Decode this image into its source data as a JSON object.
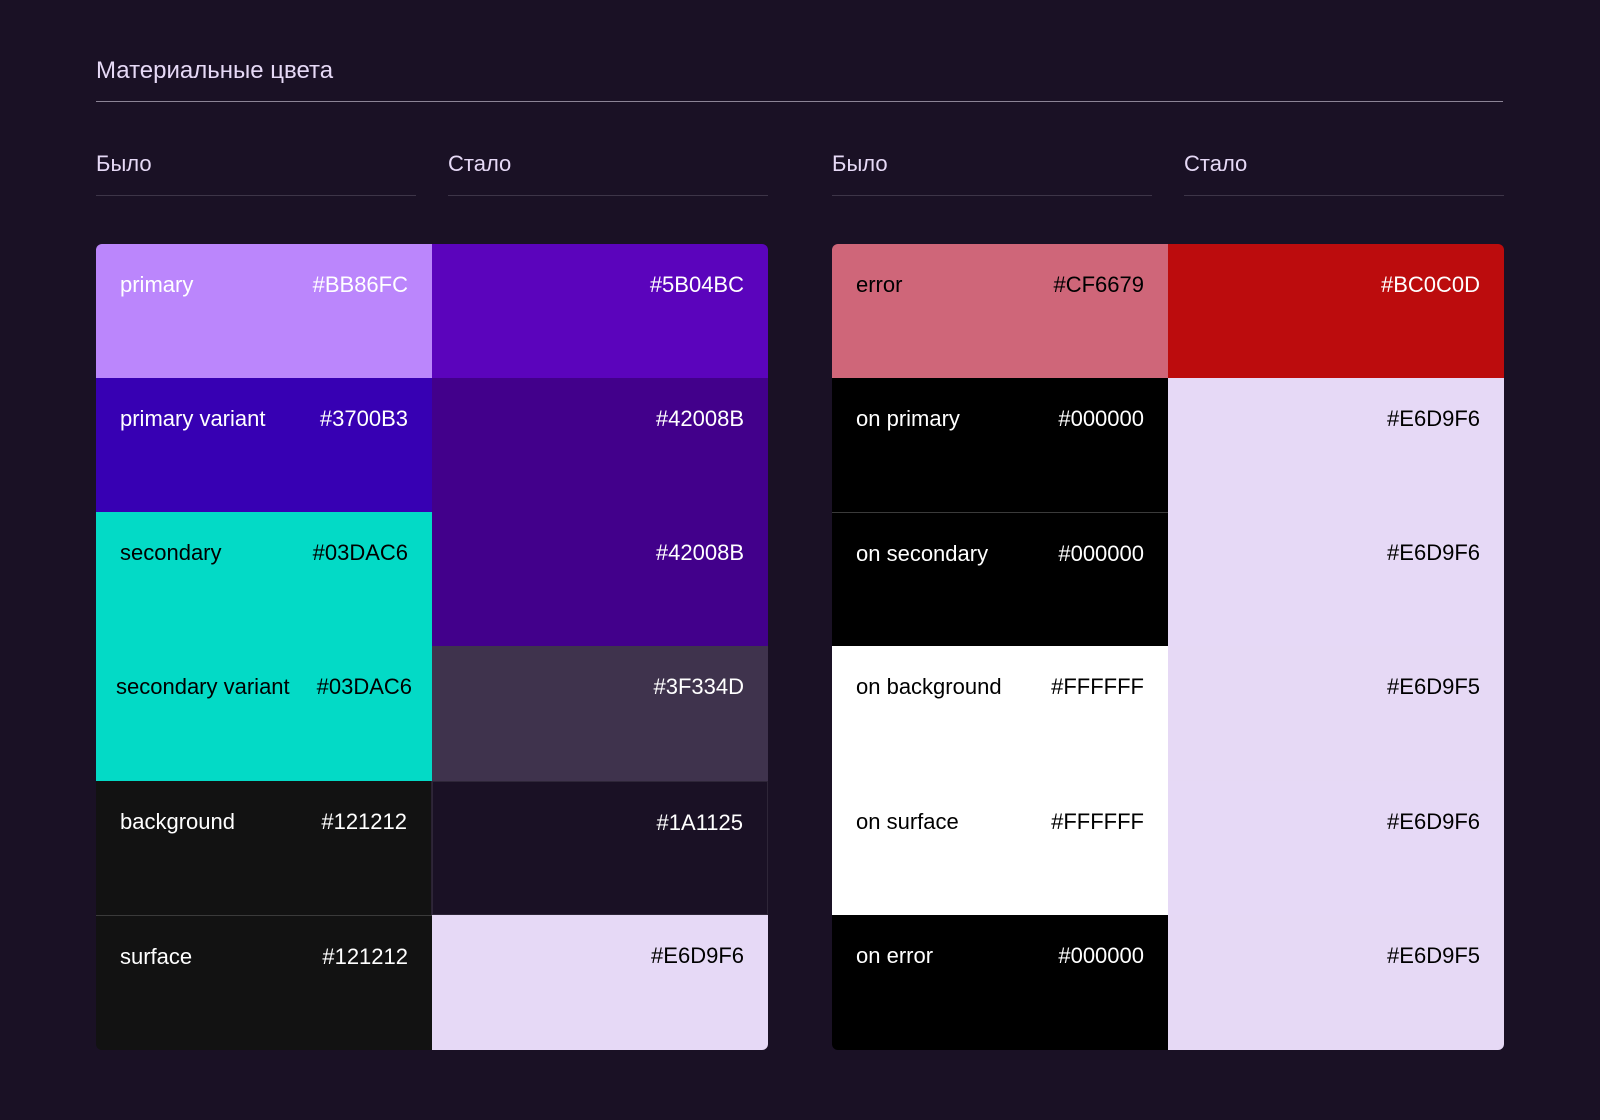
{
  "title": "Материальные цвета",
  "headers": {
    "left_before": "Было",
    "left_after": "Стало",
    "right_before": "Было",
    "right_after": "Стало"
  },
  "left": {
    "before": [
      {
        "name": "primary",
        "hex": "#BB86FC",
        "color": "#BB86FC"
      },
      {
        "name": "primary variant",
        "hex": "#3700B3",
        "color": "#3700B3"
      },
      {
        "name": "secondary",
        "hex": "#03DAC6",
        "color": "#03DAC6"
      },
      {
        "name": "secondary variant",
        "hex": "#03DAC6",
        "color": "#03DAC6"
      },
      {
        "name": "background",
        "hex": "#121212",
        "color": "#121212"
      },
      {
        "name": "surface",
        "hex": "#121212",
        "color": "#121212"
      }
    ],
    "after": [
      {
        "hex": "#5B04BC",
        "color": "#5B04BC"
      },
      {
        "hex": "#42008B",
        "color": "#42008B"
      },
      {
        "hex": "#42008B",
        "color": "#42008B"
      },
      {
        "hex": "#3F334D",
        "color": "#3F334D"
      },
      {
        "hex": "#1A1125",
        "color": "#1A1125"
      },
      {
        "hex": "#E6D9F6",
        "color": "#E6D9F6"
      }
    ]
  },
  "right": {
    "before": [
      {
        "name": "error",
        "hex": "#CF6679",
        "color": "#CF6679"
      },
      {
        "name": "on primary",
        "hex": "#000000",
        "color": "#000000"
      },
      {
        "name": "on secondary",
        "hex": "#000000",
        "color": "#000000"
      },
      {
        "name": "on background",
        "hex": "#FFFFFF",
        "color": "#FFFFFF"
      },
      {
        "name": "on surface",
        "hex": "#FFFFFF",
        "color": "#FFFFFF"
      },
      {
        "name": "on error",
        "hex": "#000000",
        "color": "#000000"
      }
    ],
    "after": [
      {
        "hex": "#BC0C0D",
        "color": "#BC0C0D"
      },
      {
        "hex": "#E6D9F6",
        "color": "#E6D9F6"
      },
      {
        "hex": "#E6D9F6",
        "color": "#E6D9F6"
      },
      {
        "hex": "#E6D9F5",
        "color": "#E6D9F5"
      },
      {
        "hex": "#E6D9F6",
        "color": "#E6D9F6"
      },
      {
        "hex": "#E6D9F5",
        "color": "#E6D9F5"
      }
    ]
  },
  "colors": {
    "page_background": "#1A1125",
    "heading_text": "#E6D9F6",
    "rule": "#8C8496"
  }
}
